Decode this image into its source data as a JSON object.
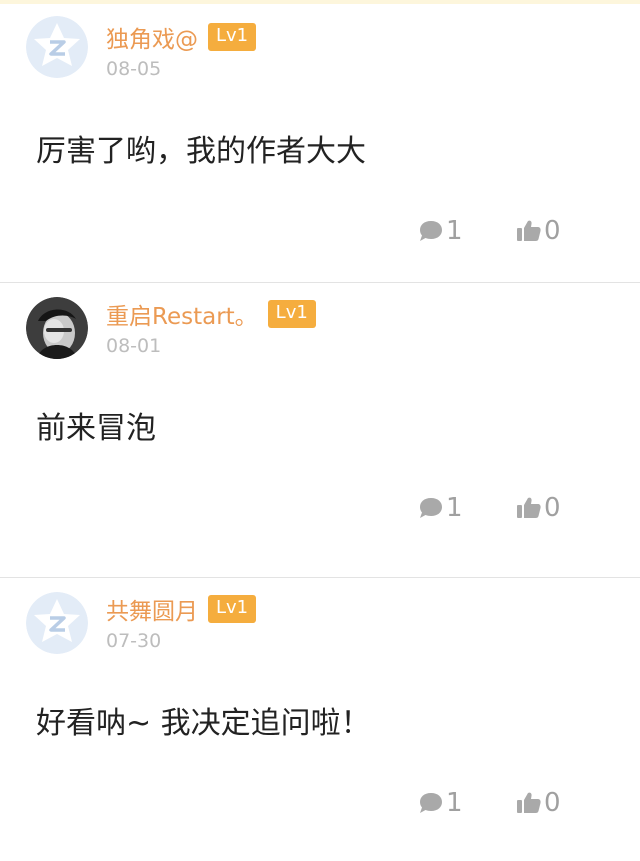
{
  "colors": {
    "username": "#eb9a53",
    "badge_bg": "#f5ad3e",
    "date": "#bdbdbd",
    "icon_gray": "#a9a9a9",
    "divider": "#e3e3e3"
  },
  "comments": [
    {
      "username": "独角戏@",
      "level": "Lv1",
      "date": "08-05",
      "content": "厉害了哟，我的作者大大",
      "reply_count": "1",
      "like_count": "0",
      "avatar": "default-qzone-avatar"
    },
    {
      "username": "重启Restart。",
      "level": "Lv1",
      "date": "08-01",
      "content": "前来冒泡",
      "reply_count": "1",
      "like_count": "0",
      "avatar": "user-photo-avatar"
    },
    {
      "username": "共舞圆月",
      "level": "Lv1",
      "date": "07-30",
      "content": "好看呐~ 我决定追问啦！",
      "reply_count": "1",
      "like_count": "0",
      "avatar": "default-qzone-avatar"
    }
  ]
}
